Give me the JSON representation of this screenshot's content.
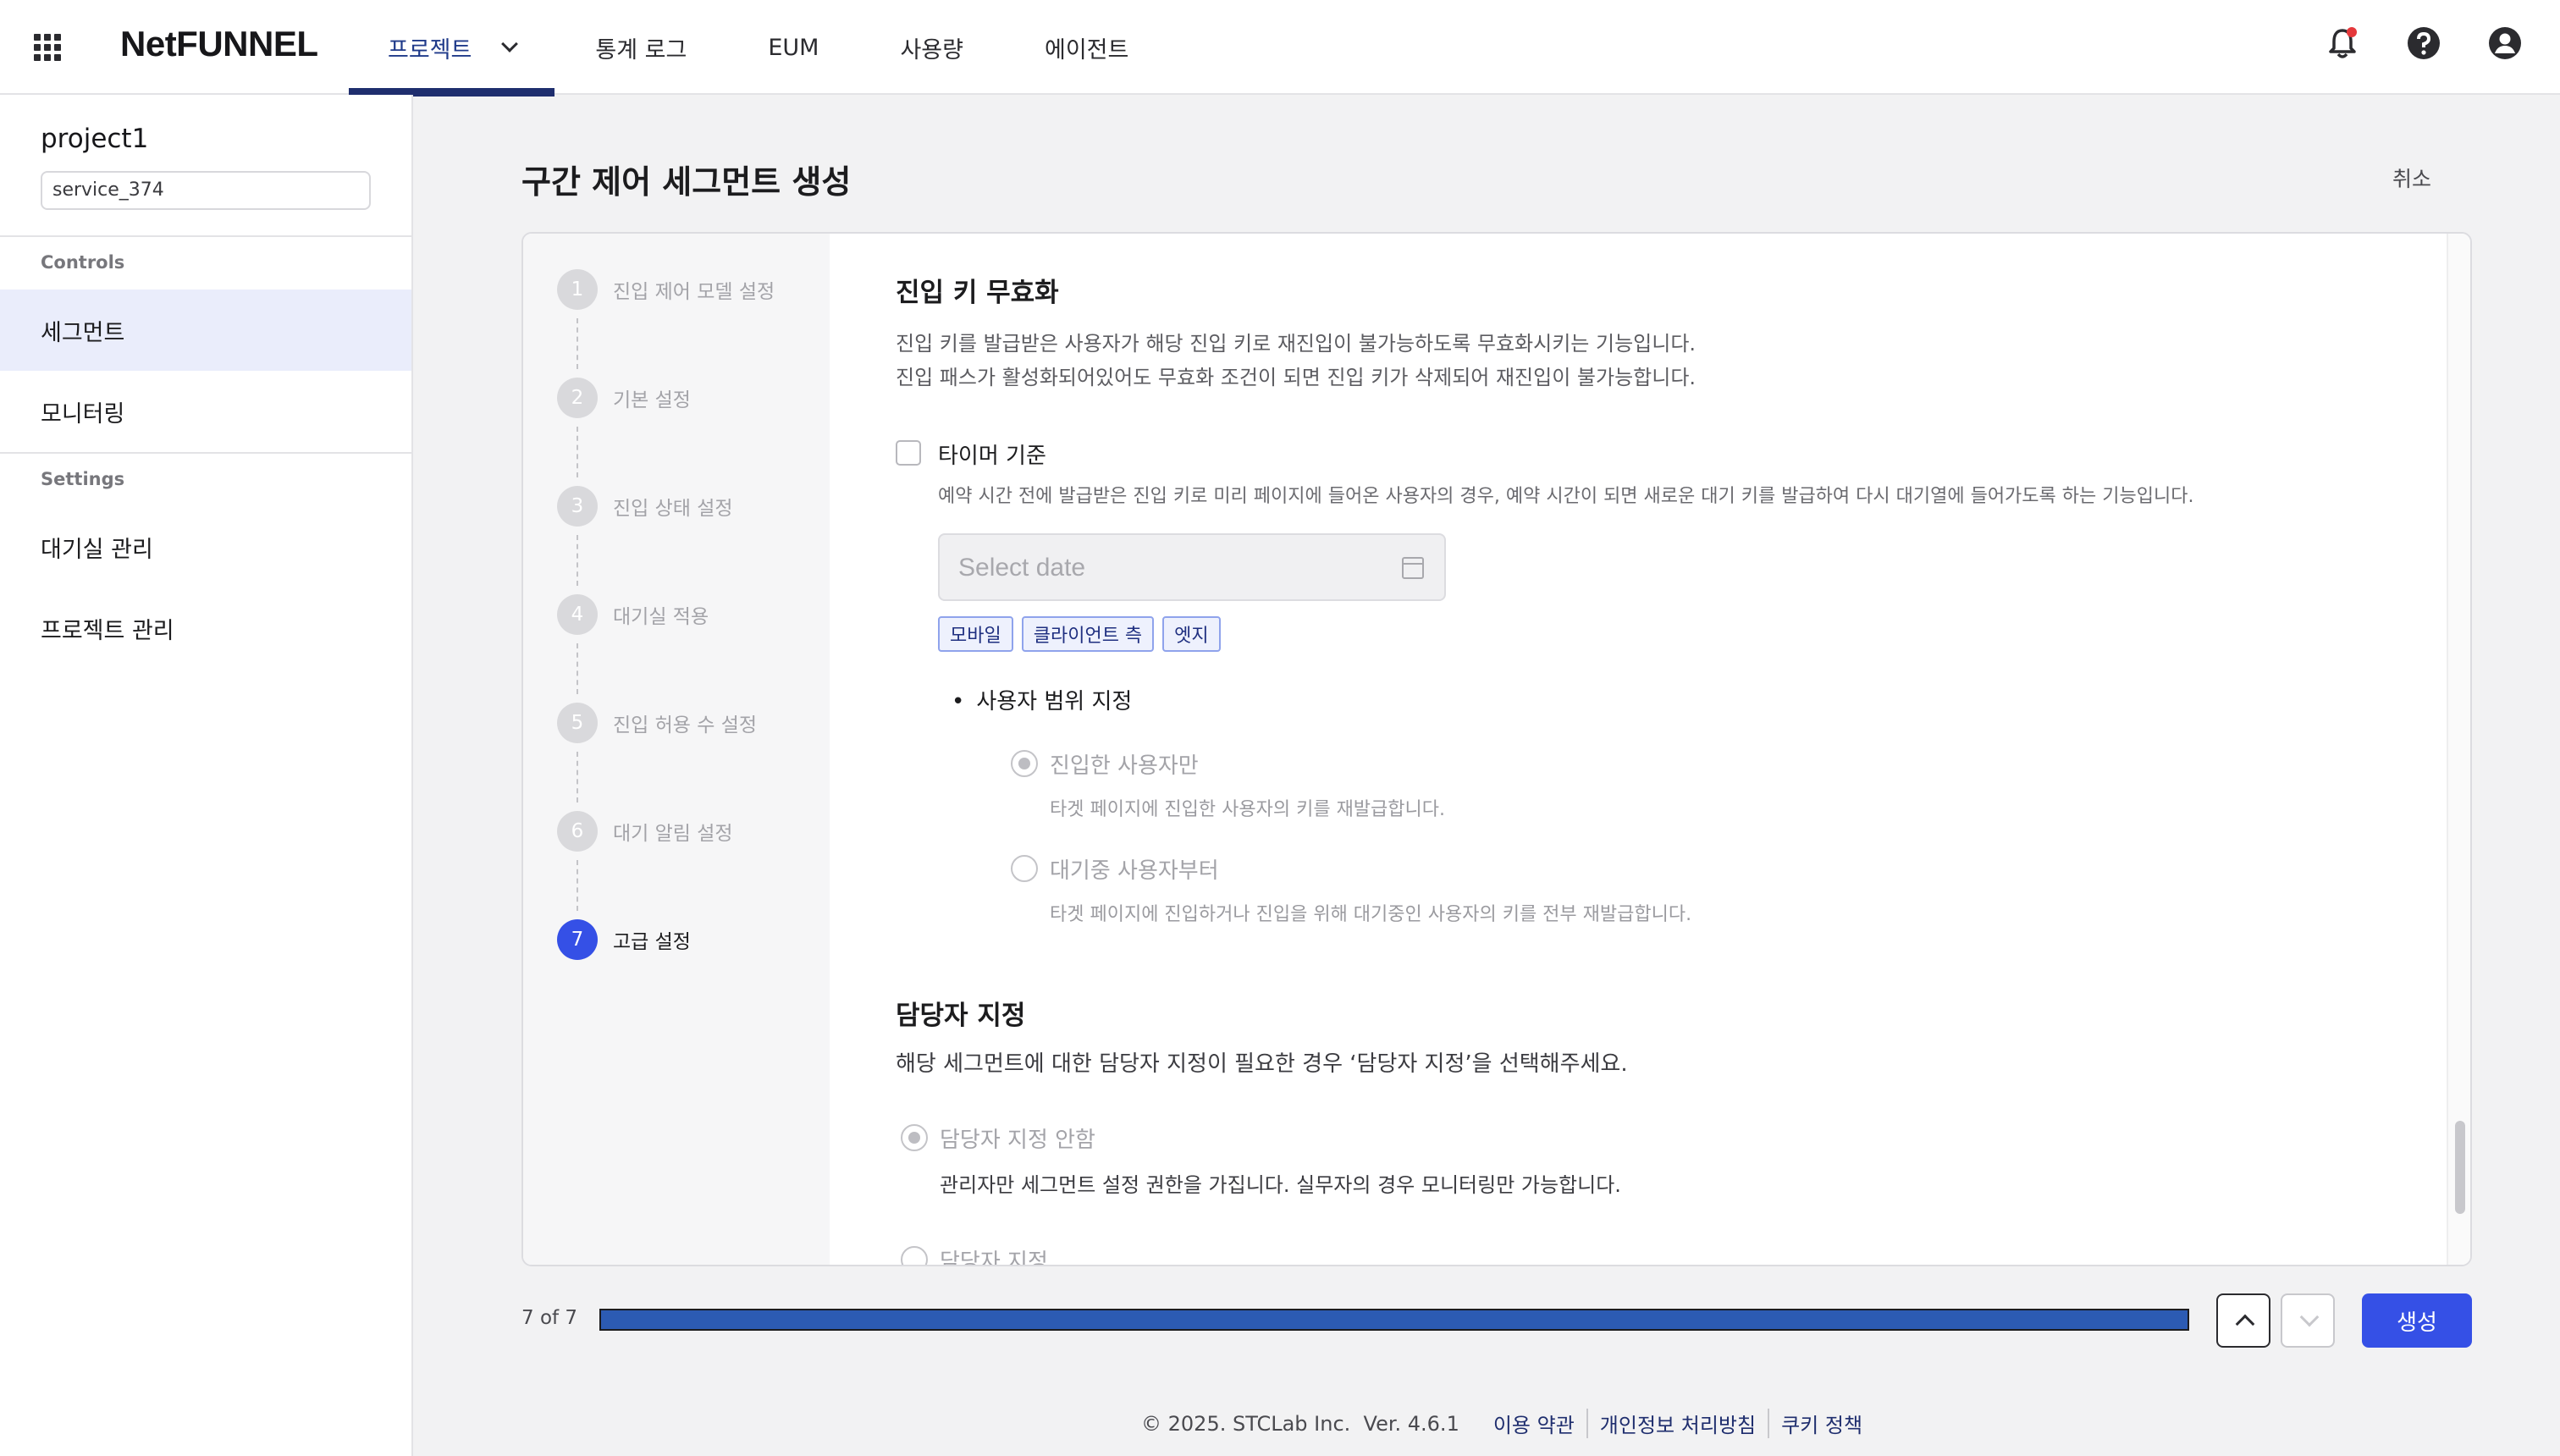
{
  "header": {
    "logo": "NetFUNNEL",
    "nav": [
      {
        "label": "프로젝트"
      },
      {
        "label": "통계 로그"
      },
      {
        "label": "EUM"
      },
      {
        "label": "사용량"
      },
      {
        "label": "에이전트"
      }
    ],
    "icons": [
      "notification-bell-icon",
      "help-icon",
      "user-account-icon"
    ]
  },
  "sidebar": {
    "project_name": "project1",
    "service_name": "service_374",
    "group_controls": "Controls",
    "group_settings": "Settings",
    "items": [
      {
        "label": "세그먼트",
        "active": true
      },
      {
        "label": "모니터링"
      },
      {
        "label": "대기실 관리"
      },
      {
        "label": "프로젝트 관리"
      }
    ]
  },
  "page": {
    "title": "구간 제어 세그먼트 생성",
    "cancel_label": "취소"
  },
  "steps": [
    {
      "num": "1",
      "label": "진입 제어 모델 설정"
    },
    {
      "num": "2",
      "label": "기본 설정"
    },
    {
      "num": "3",
      "label": "진입 상태 설정"
    },
    {
      "num": "4",
      "label": "대기실 적용"
    },
    {
      "num": "5",
      "label": "진입 허용 수 설정"
    },
    {
      "num": "6",
      "label": "대기 알림 설정"
    },
    {
      "num": "7",
      "label": "고급 설정",
      "active": true
    }
  ],
  "invalidation": {
    "title": "진입 키 무효화",
    "desc1": "진입 키를 발급받은 사용자가 해당 진입 키로 재진입이 불가능하도록 무효화시키는 기능입니다.",
    "desc2": "진입 패스가 활성화되어있어도 무효화 조건이 되면 진입 키가 삭제되어 재진입이 불가능합니다.",
    "timer_label": "타이머 기준",
    "timer_checked": false,
    "timer_desc": "예약 시간 전에 발급받은 진입 키로 미리 페이지에 들어온 사용자의 경우, 예약 시간이 되면 새로운 대기 키를 발급하여 다시 대기열에 들어가도록 하는 기능입니다.",
    "date_placeholder": "Select date",
    "tags": [
      "모바일",
      "클라이언트 측",
      "엣지"
    ],
    "scope_title": "사용자 범위 지정",
    "scope_options": [
      {
        "label": "진입한 사용자만",
        "desc": "타겟 페이지에 진입한 사용자의 키를 재발급합니다.",
        "checked": true
      },
      {
        "label": "대기중 사용자부터",
        "desc": "타겟 페이지에 진입하거나 진입을 위해 대기중인 사용자의 키를 전부 재발급합니다.",
        "checked": false
      }
    ]
  },
  "manager": {
    "title": "담당자 지정",
    "desc": "해당 세그먼트에 대한 담당자 지정이 필요한 경우 ‘담당자 지정’을 선택해주세요.",
    "options": [
      {
        "label": "담당자 지정 안함",
        "desc": "관리자만 세그먼트 설정 권한을 가집니다. 실무자의 경우 모니터링만 가능합니다.",
        "checked": true
      },
      {
        "label": "담당자 지정",
        "checked": false
      }
    ]
  },
  "progress": {
    "text": "7 of 7",
    "fraction": 1.0,
    "create_label": "생성"
  },
  "footer": {
    "copyright": "© 2025. STCLab Inc.  Ver. 4.6.1",
    "links": [
      "이용 약관",
      "개인정보 처리방침",
      "쿠키 정책"
    ]
  },
  "colors": {
    "primary": "#3550e6",
    "nav_active": "#1f2e6e",
    "progress": "#2c5bb3"
  }
}
